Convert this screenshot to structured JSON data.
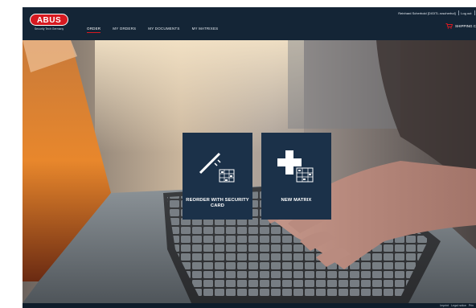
{
  "brand": {
    "logo_text": "ABUS",
    "tagline": "Security Tech Germany",
    "colors": {
      "red": "#d71920",
      "navy": "#142536",
      "tile": "#1b3149"
    }
  },
  "nav": {
    "items": [
      {
        "label": "ORDER",
        "active": true
      },
      {
        "label": "MY ORDERS",
        "active": false
      },
      {
        "label": "MY DOCUMENTS",
        "active": false
      },
      {
        "label": "MY MATRIXES",
        "active": false
      }
    ]
  },
  "user": {
    "name": "Reinhard Scherhold [DIGITL.roscherhol]",
    "logout_label": "Log out"
  },
  "cart": {
    "icon": "cart-icon",
    "label": "SHIPPING C"
  },
  "tiles": [
    {
      "label": "REORDER WITH SECURITY CARD",
      "icon": "key-card-icon"
    },
    {
      "label": "NEW MATRIX",
      "icon": "plus-grid-icon"
    }
  ],
  "footer": {
    "links": [
      "Imprint",
      "Legal notice",
      "Priv"
    ]
  }
}
